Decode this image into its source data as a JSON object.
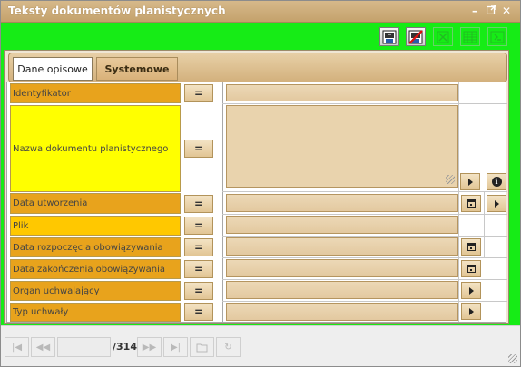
{
  "window": {
    "title": "Teksty dokumentów planistycznych",
    "controls": [
      "minimize-icon",
      "popout-icon",
      "close-icon"
    ]
  },
  "toolbar": {
    "tools": [
      {
        "name": "export-icon",
        "enabled": true
      },
      {
        "name": "cancel-export-icon",
        "enabled": true
      },
      {
        "name": "excel-icon",
        "enabled": false
      },
      {
        "name": "table-icon",
        "enabled": false
      },
      {
        "name": "sum-icon",
        "enabled": false
      }
    ]
  },
  "tabs": [
    {
      "label": "Dane opisowe",
      "active": true
    },
    {
      "label": "Systemowe",
      "active": false
    }
  ],
  "operator_label": "=",
  "fields": [
    {
      "label": "Identyfikator",
      "color": "#e8a31c",
      "value": ""
    },
    {
      "label": "Nazwa dokumentu planistycznego",
      "color": "#ffff00",
      "value": ""
    },
    {
      "label": "Data utworzenia",
      "color": "#e8a31c",
      "value": ""
    },
    {
      "label": "Plik",
      "color": "#ffc800",
      "value": ""
    },
    {
      "label": "Data rozpoczęcia obowiązywania",
      "color": "#e8a31c",
      "value": ""
    },
    {
      "label": "Data zakończenia obowiązywania",
      "color": "#e8a31c",
      "value": ""
    },
    {
      "label": "Organ uchwalający",
      "color": "#e8a31c",
      "value": ""
    },
    {
      "label": "Typ uchwały",
      "color": "#e8a31c",
      "value": ""
    }
  ],
  "pagination": {
    "current_page": "",
    "total_label": "/314",
    "buttons": [
      "first-page-icon",
      "prev-page-icon",
      "next-page-icon",
      "last-page-icon",
      "open-icon",
      "refresh-icon"
    ]
  },
  "colors": {
    "highlight": "#16ec16",
    "title_bar": "#c9a772"
  }
}
